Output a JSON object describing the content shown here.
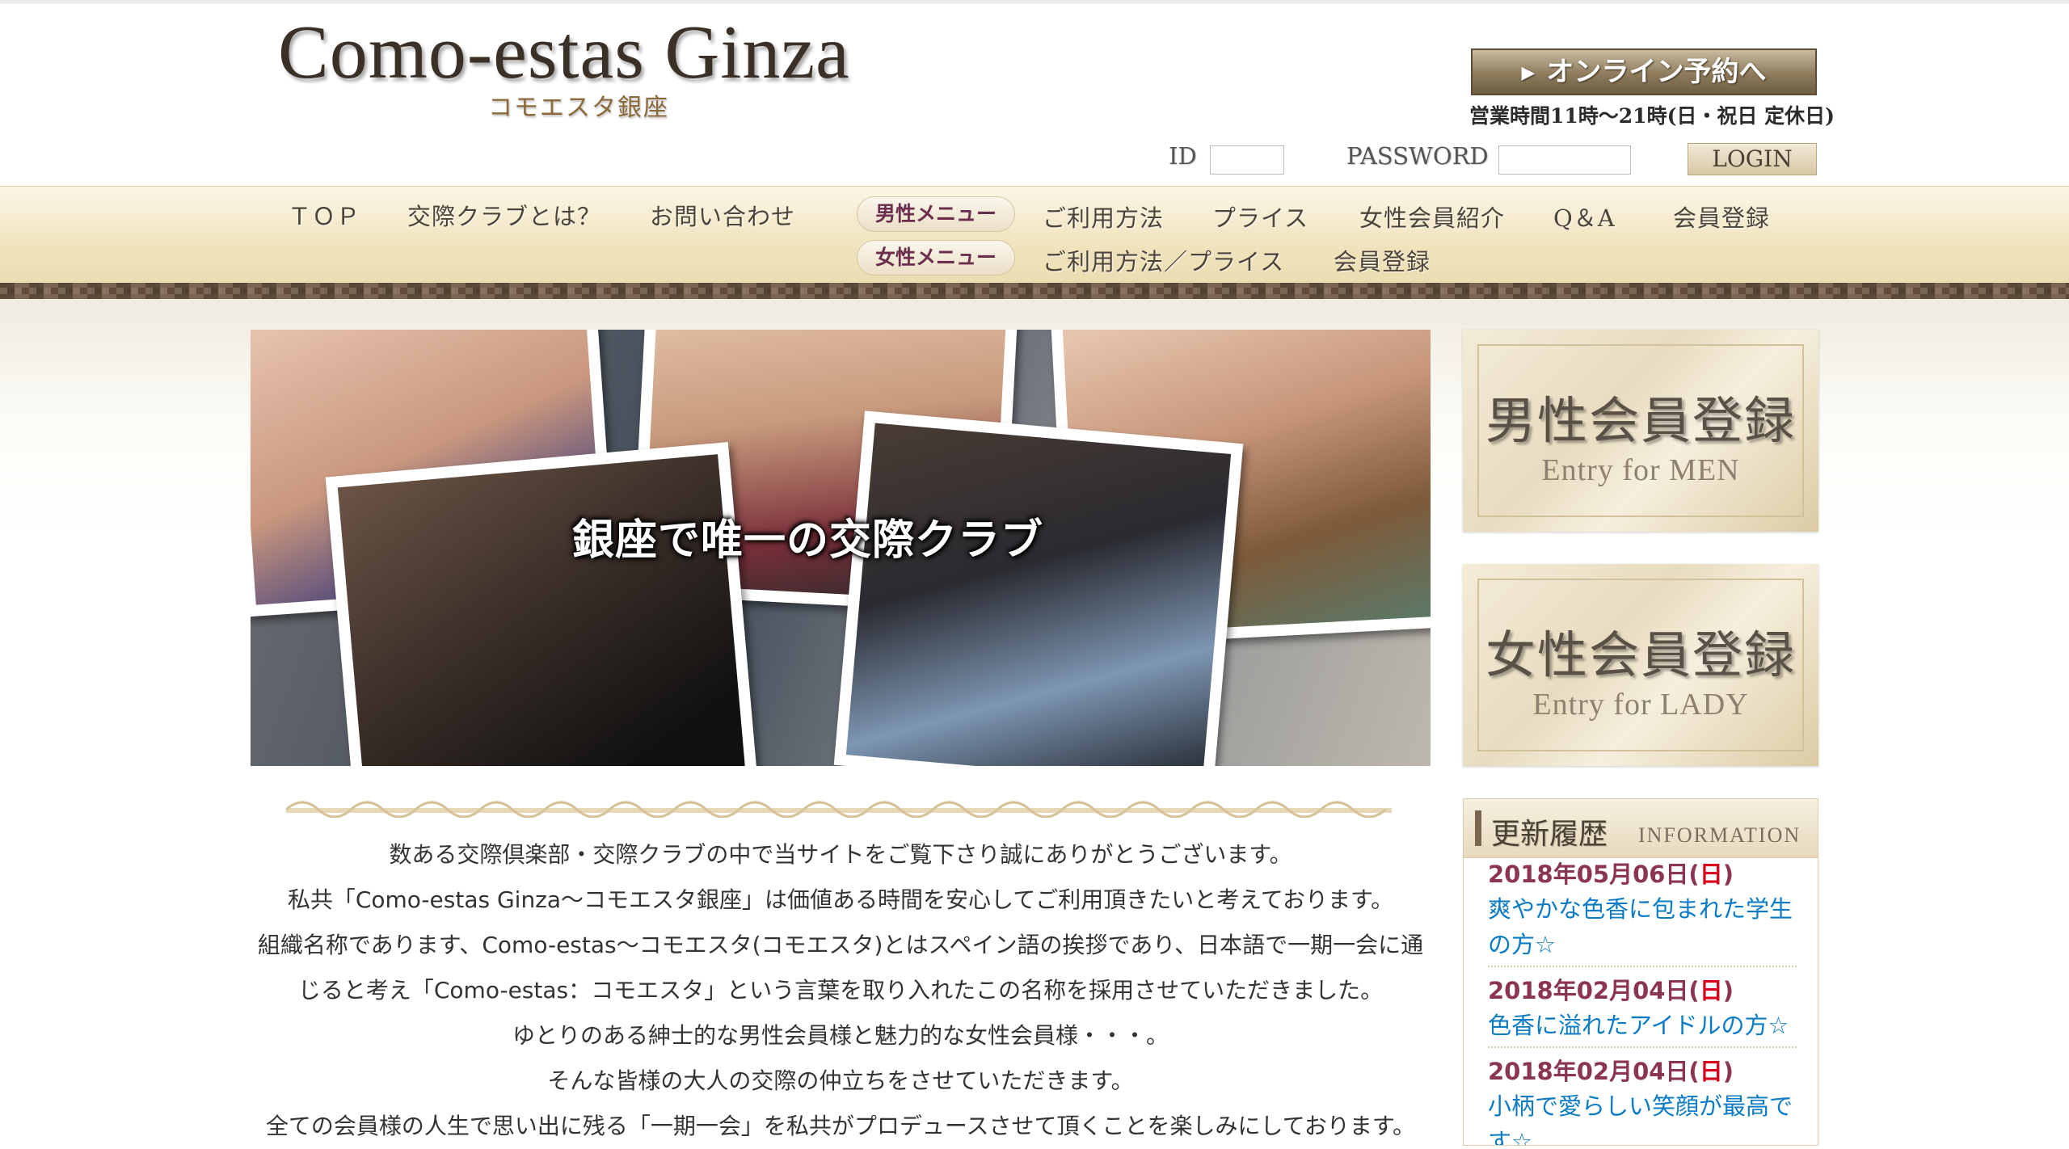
{
  "header": {
    "logo_main": "Como-estas Ginza",
    "logo_sub": "コモエスタ銀座",
    "reserve_label": "オンライン予約へ",
    "hours": "営業時間11時～21時(日・祝日 定休日)"
  },
  "login": {
    "id_label": "ID",
    "password_label": "PASSWORD",
    "id_value": "",
    "password_value": "",
    "button": "LOGIN"
  },
  "nav": {
    "top": "ＴＯＰ",
    "about": "交際クラブとは？",
    "contact": "お問い合わせ",
    "men_menu": "男性メニュー",
    "men_items": [
      "ご利用方法",
      "プライス",
      "女性会員紹介",
      "Q＆A",
      "会員登録"
    ],
    "women_menu": "女性メニュー",
    "women_items": [
      "ご利用方法／プライス",
      "会員登録"
    ]
  },
  "hero": {
    "caption": "銀座で唯一の交際クラブ"
  },
  "entries": {
    "men_jp": "男性会員登録",
    "men_en": "Entry for MEN",
    "lady_jp": "女性会員登録",
    "lady_en": "Entry for LADY"
  },
  "info": {
    "title_jp": "更新履歴",
    "title_en": "INFORMATION",
    "items": [
      {
        "date": "2018年05月06日(",
        "day": "日",
        "close": ")",
        "title": "爽やかな色香に包まれた学生の方☆"
      },
      {
        "date": "2018年02月04日(",
        "day": "日",
        "close": ")",
        "title": "色香に溢れたアイドルの方☆"
      },
      {
        "date": "2018年02月04日(",
        "day": "日",
        "close": ")",
        "title": "小柄で愛らしい笑顔が最高です☆"
      }
    ]
  },
  "intro": [
    "数ある交際倶楽部・交際クラブの中で当サイトをご覧下さり誠にありがとうございます。",
    "私共「Como-estas Ginza～コモエスタ銀座」は価値ある時間を安心してご利用頂きたいと考えております。",
    "組織名称であります、Como-estas～コモエスタ(コモエスタ)とはスペイン語の挨拶であり、日本語で一期一会に通",
    "じると考え「Como-estas：コモエスタ」という言葉を取り入れたこの名称を採用させていただきました。",
    "ゆとりのある紳士的な男性会員様と魅力的な女性会員様・・・。",
    "そんな皆様の大人の交際の仲立ちをさせていただきます。",
    "全ての会員様の人生で思い出に残る「一期一会」を私共がプロデュースさせて頂くことを楽しみにしております。"
  ],
  "colors": {
    "nav_bg": "#f0e3bd",
    "accent_brown": "#6f5e44",
    "date_color": "#8b3552",
    "sunday_red": "#d8001c",
    "link_blue": "#0a7bc4"
  }
}
